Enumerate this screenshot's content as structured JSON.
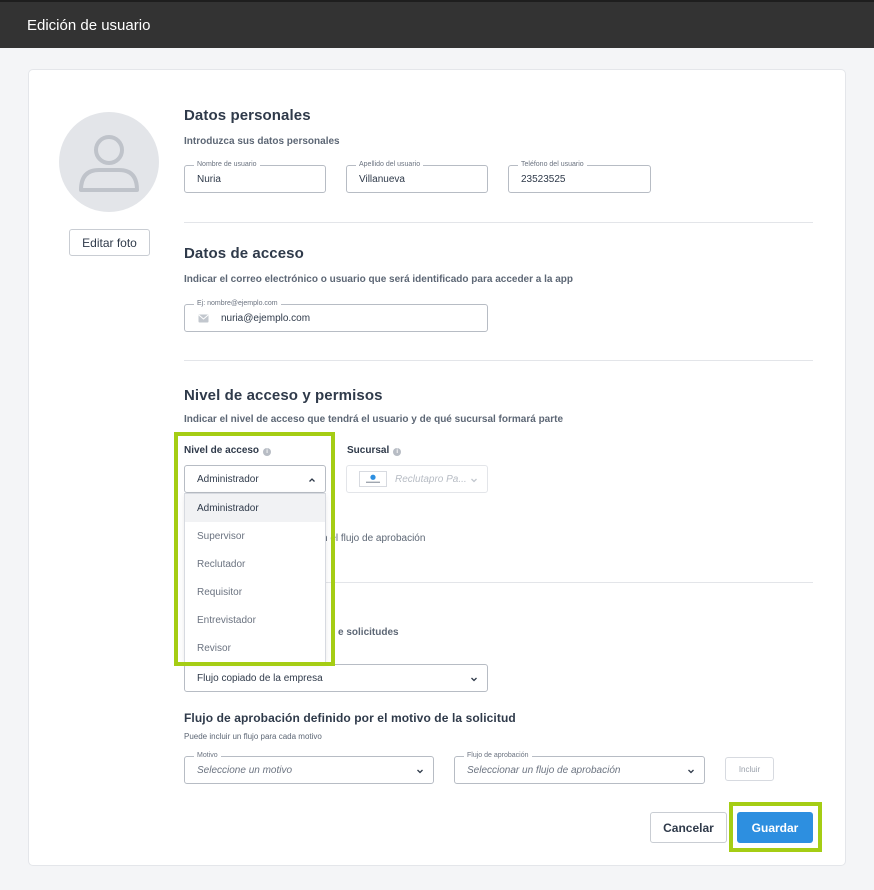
{
  "window": {
    "title": "Edición de usuario"
  },
  "profile": {
    "edit_photo_label": "Editar foto"
  },
  "personal": {
    "title": "Datos personales",
    "subtitle": "Introduzca sus datos personales",
    "name_label": "Nombre de usuario",
    "name_value": "Nuria",
    "surname_label": "Apellido del usuario",
    "surname_value": "Villanueva",
    "phone_label": "Teléfono del usuario",
    "phone_value": "23523525"
  },
  "access": {
    "title": "Datos de acceso",
    "subtitle": "Indicar el correo electrónico o usuario que será identificado para acceder a la app",
    "email_label": "Ej: nombre@ejemplo.com",
    "email_value": "nuria@ejemplo.com"
  },
  "permissions": {
    "title": "Nivel de acceso y permisos",
    "subtitle": "Indicar el nivel de acceso que tendrá el usuario y de qué sucursal formará parte",
    "level_label": "Nivel de acceso",
    "level_value": "Administrador",
    "branch_label": "Sucursal",
    "branch_value": "Reclutapro Pa...",
    "level_options": [
      "Administrador",
      "Supervisor",
      "Reclutador",
      "Requisitor",
      "Entrevistador",
      "Revisor"
    ],
    "partial_flow_text": "n el flujo de aprobación",
    "partial_requests_text": "e solicitudes"
  },
  "approval": {
    "flow_value": "Flujo copiado de la empresa",
    "by_reason_title": "Flujo de aprobación definido por el motivo de la solicitud",
    "by_reason_subtitle": "Puede incluir un flujo para cada motivo",
    "reason_label": "Motivo",
    "reason_placeholder": "Seleccione un motivo",
    "flow_label": "Flujo de aprobación",
    "flow_placeholder": "Seleccionar un flujo de aprobación",
    "include_label": "Incluir"
  },
  "actions": {
    "cancel_label": "Cancelar",
    "save_label": "Guardar"
  },
  "colors": {
    "topbar": "#333333",
    "primary": "#2d8fe0",
    "highlight": "#a5cd14"
  }
}
